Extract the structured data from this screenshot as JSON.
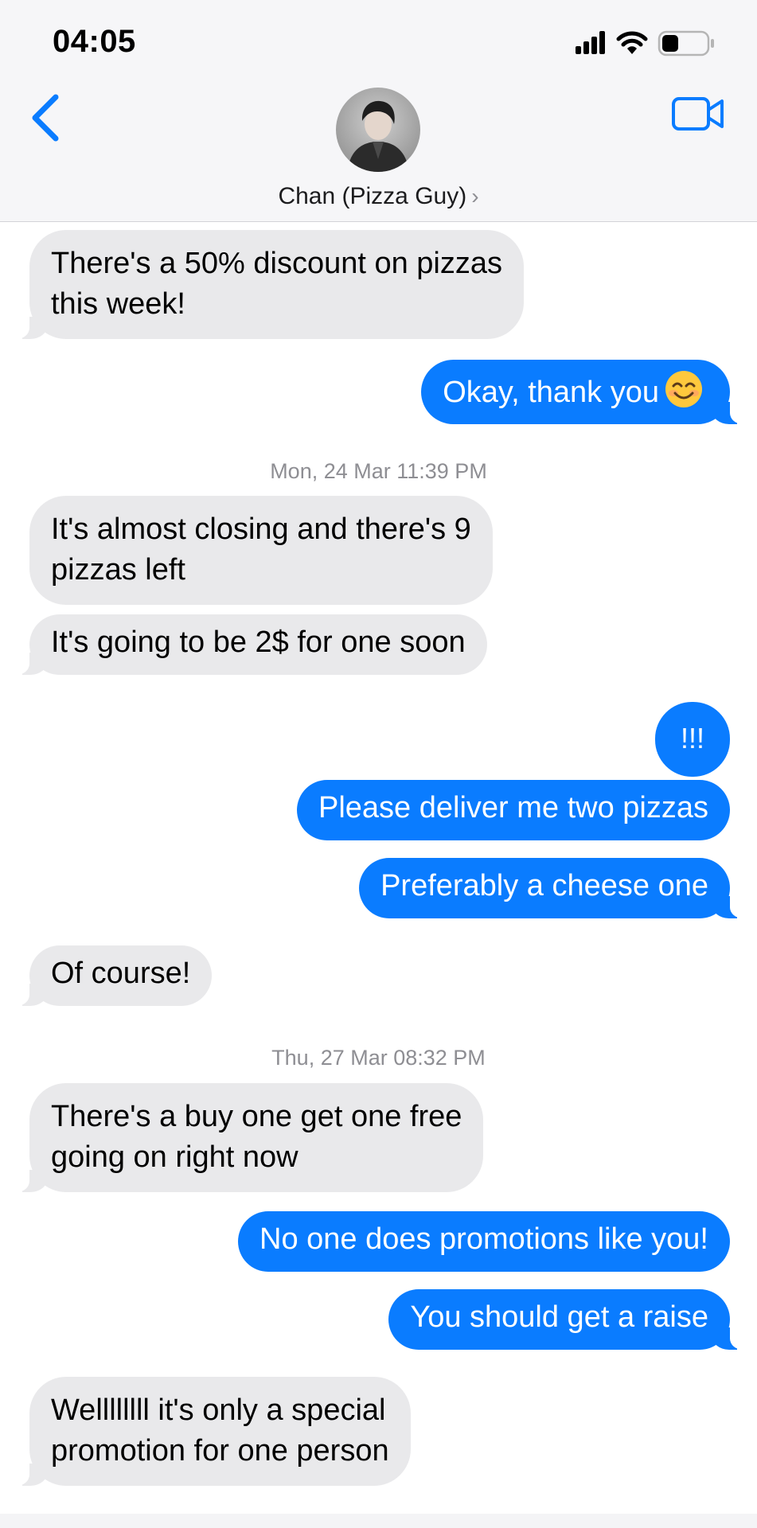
{
  "status_bar": {
    "time": "04:05",
    "icons": [
      "cellular-signal-icon",
      "wifi-icon",
      "battery-icon"
    ]
  },
  "header": {
    "back_icon": "chevron-left-icon",
    "contact_name": "Chan (Pizza Guy)",
    "contact_chevron": "›",
    "video_icon": "video-camera-icon"
  },
  "colors": {
    "accent": "#0a7cff",
    "incoming_bubble": "#e9e9eb",
    "timestamp": "#8e8e93"
  },
  "messages": [
    {
      "from": "them",
      "lines": [
        "There's a 50% discount on pizzas",
        "this week!"
      ]
    },
    {
      "from": "me",
      "text": "Okay, thank you",
      "emoji": "smiling-face-icon"
    },
    {
      "timestamp": "Mon, 24 Mar 11:39 PM"
    },
    {
      "from": "them",
      "lines": [
        "It's almost closing and there's 9",
        "pizzas left"
      ]
    },
    {
      "from": "them",
      "text": "It's going to be 2$ for one soon"
    },
    {
      "from": "me",
      "text": "!!!"
    },
    {
      "from": "me",
      "text": "Please deliver me two pizzas"
    },
    {
      "from": "me",
      "text": "Preferably a cheese one"
    },
    {
      "from": "them",
      "text": "Of course!"
    },
    {
      "timestamp": "Thu, 27 Mar 08:32 PM"
    },
    {
      "from": "them",
      "lines": [
        "There's a buy one get one free",
        "going on right now"
      ]
    },
    {
      "from": "me",
      "text": "No one does promotions like you!"
    },
    {
      "from": "me",
      "text": "You should get a raise"
    },
    {
      "from": "them",
      "lines": [
        "Wellllllll it's only a special",
        "promotion for one person"
      ]
    }
  ]
}
